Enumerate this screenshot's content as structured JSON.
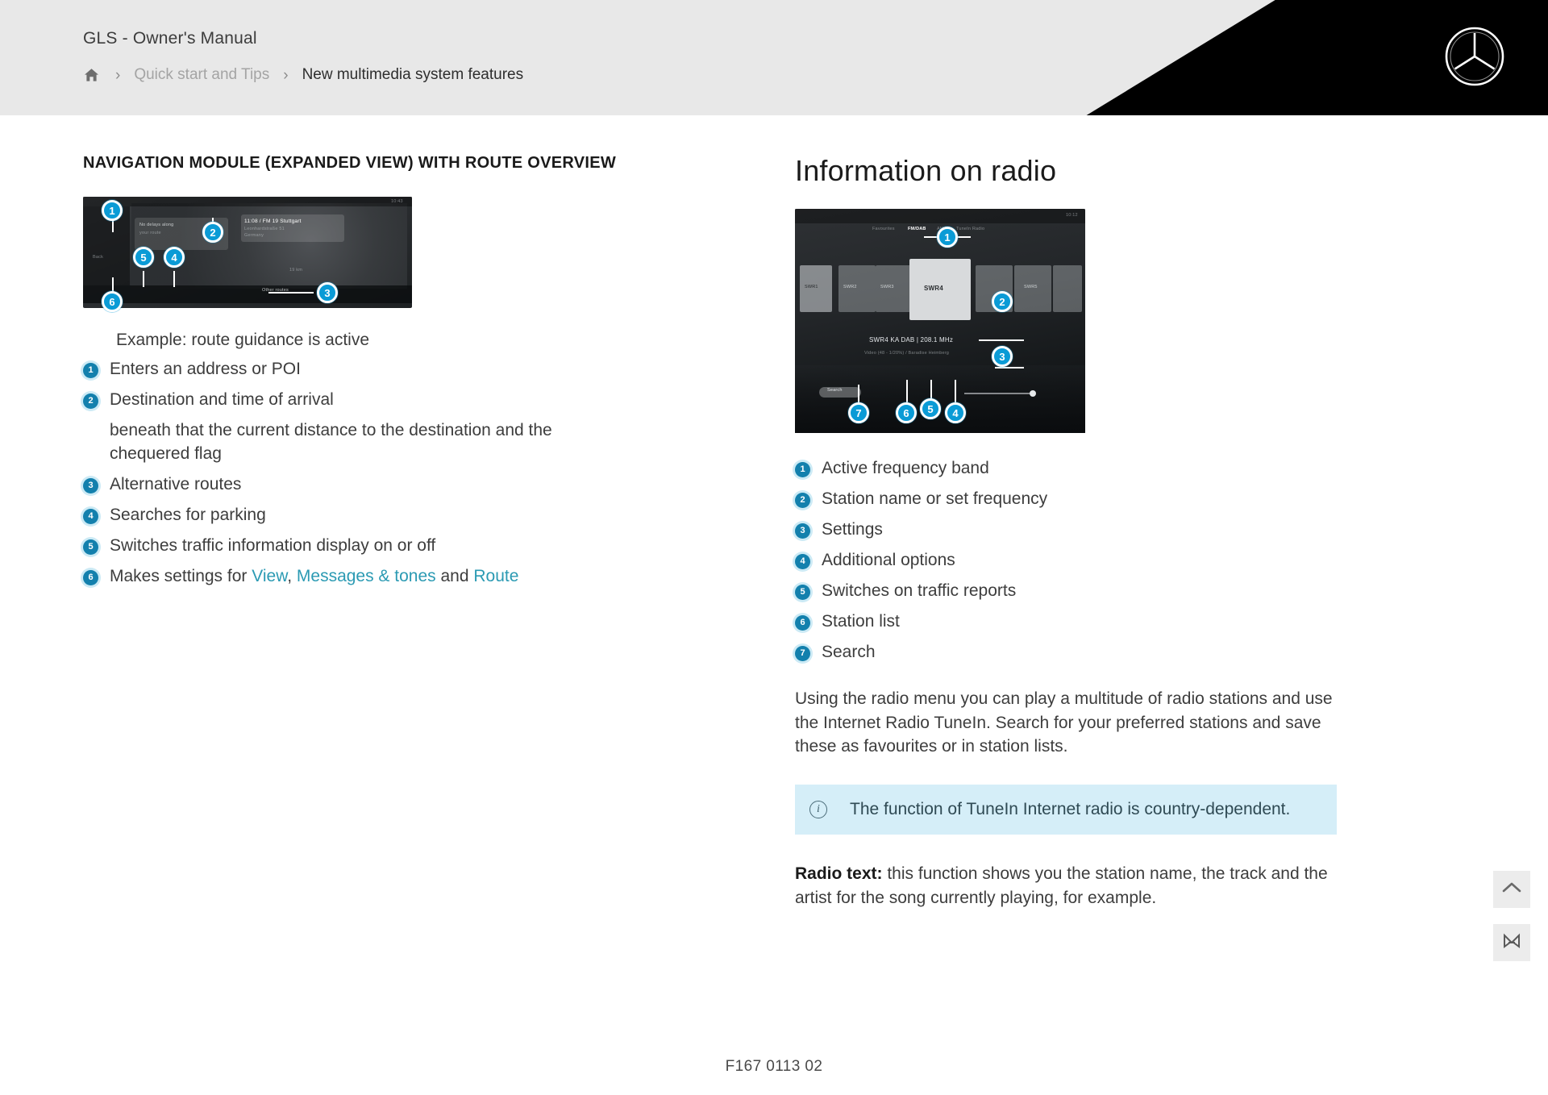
{
  "header": {
    "manual_title": "GLS - Owner's Manual",
    "breadcrumb": {
      "home_icon": "home-icon",
      "separator": "›",
      "parent": "Quick start and Tips",
      "current": "New multimedia system features"
    },
    "brand_logo": "mercedes-benz-star-icon"
  },
  "left_column": {
    "title": "NAVIGATION MODULE (EXPANDED VIEW) WITH ROUTE OVERVIEW",
    "illustration": {
      "name": "navigation-module-screenshot",
      "callouts": [
        "1",
        "2",
        "3",
        "4",
        "5",
        "6"
      ],
      "screen_labels": {
        "destination": "11:08 / FM 19 Stuttgart",
        "destination_sub": "Leonhardstraße 51",
        "destination_sub2": "Germany",
        "status_time": "10:43",
        "card_line1": "No delays along",
        "card_line2": "your route",
        "distance": "19 km",
        "bottom_button": "Other routes",
        "back_button": "Back"
      }
    },
    "example_line": "Example: route guidance is active",
    "items": [
      {
        "num": "1",
        "text": "Enters an address or POI"
      },
      {
        "num": "2",
        "text": "Destination and time of arrival"
      },
      {
        "num": "3",
        "text": "Alternative routes"
      },
      {
        "num": "4",
        "text": "Searches for parking"
      },
      {
        "num": "5",
        "text": "Switches traffic information display on or off"
      }
    ],
    "sub_line": "beneath that the current distance to the destination and the chequered flag",
    "item6": {
      "num": "6",
      "prefix": "Makes settings for ",
      "link1": "View",
      "mid1": ", ",
      "link2": "Messages & tones",
      "mid2": " and ",
      "link3": "Route"
    }
  },
  "right_column": {
    "title": "Information on radio",
    "illustration": {
      "name": "radio-module-screenshot",
      "callouts": [
        "1",
        "2",
        "3",
        "4",
        "5",
        "6",
        "7"
      ],
      "screen_labels": {
        "tab1": "Favourites",
        "tab2": "FM/DAB",
        "tab3": "AM",
        "tab4": "TuneIn Radio",
        "station_line": "SWR4 KA DAB | 208.1 MHz",
        "station_sub": "Video (48 - 1/20%) / Baradise Heimberg",
        "cover1": "SWR1",
        "cover2": "SWR2",
        "cover3": "SWR3",
        "cover4": "SWR4",
        "cover5": "SWR5",
        "search_label": "Search",
        "status_time": "10:12"
      }
    },
    "items": [
      {
        "num": "1",
        "text": "Active frequency band"
      },
      {
        "num": "2",
        "text": "Station name or set frequency"
      },
      {
        "num": "3",
        "text": "Settings"
      },
      {
        "num": "4",
        "text": "Additional options"
      },
      {
        "num": "5",
        "text": "Switches on traffic reports"
      },
      {
        "num": "6",
        "text": "Station list"
      },
      {
        "num": "7",
        "text": "Search"
      }
    ],
    "paragraph": "Using the radio menu you can play a multitude of radio stations and use the Internet Radio TuneIn. Search for your preferred stations and save these as favourites or in station lists.",
    "info_box": {
      "icon": "info-icon",
      "text": "The function of TuneIn Internet radio is country-dependent."
    },
    "radio_text": {
      "label": "Radio text:",
      "body": " this function shows you the station name, the track and the artist for the song currently playing, for example."
    }
  },
  "footer": {
    "code": "F167 0113 02"
  },
  "floating_buttons": [
    {
      "name": "scroll-to-top-button",
      "icon": "chevron-up-icon"
    },
    {
      "name": "bookmark-button",
      "icon": "bookmark-ribbon-icon"
    }
  ],
  "colors": {
    "accent_blue": "#0a9bd6",
    "badge_blue": "#1380ad",
    "link_teal": "#2b9ab3",
    "info_bg": "#d5eef8",
    "header_bg": "#e8e8e8"
  }
}
